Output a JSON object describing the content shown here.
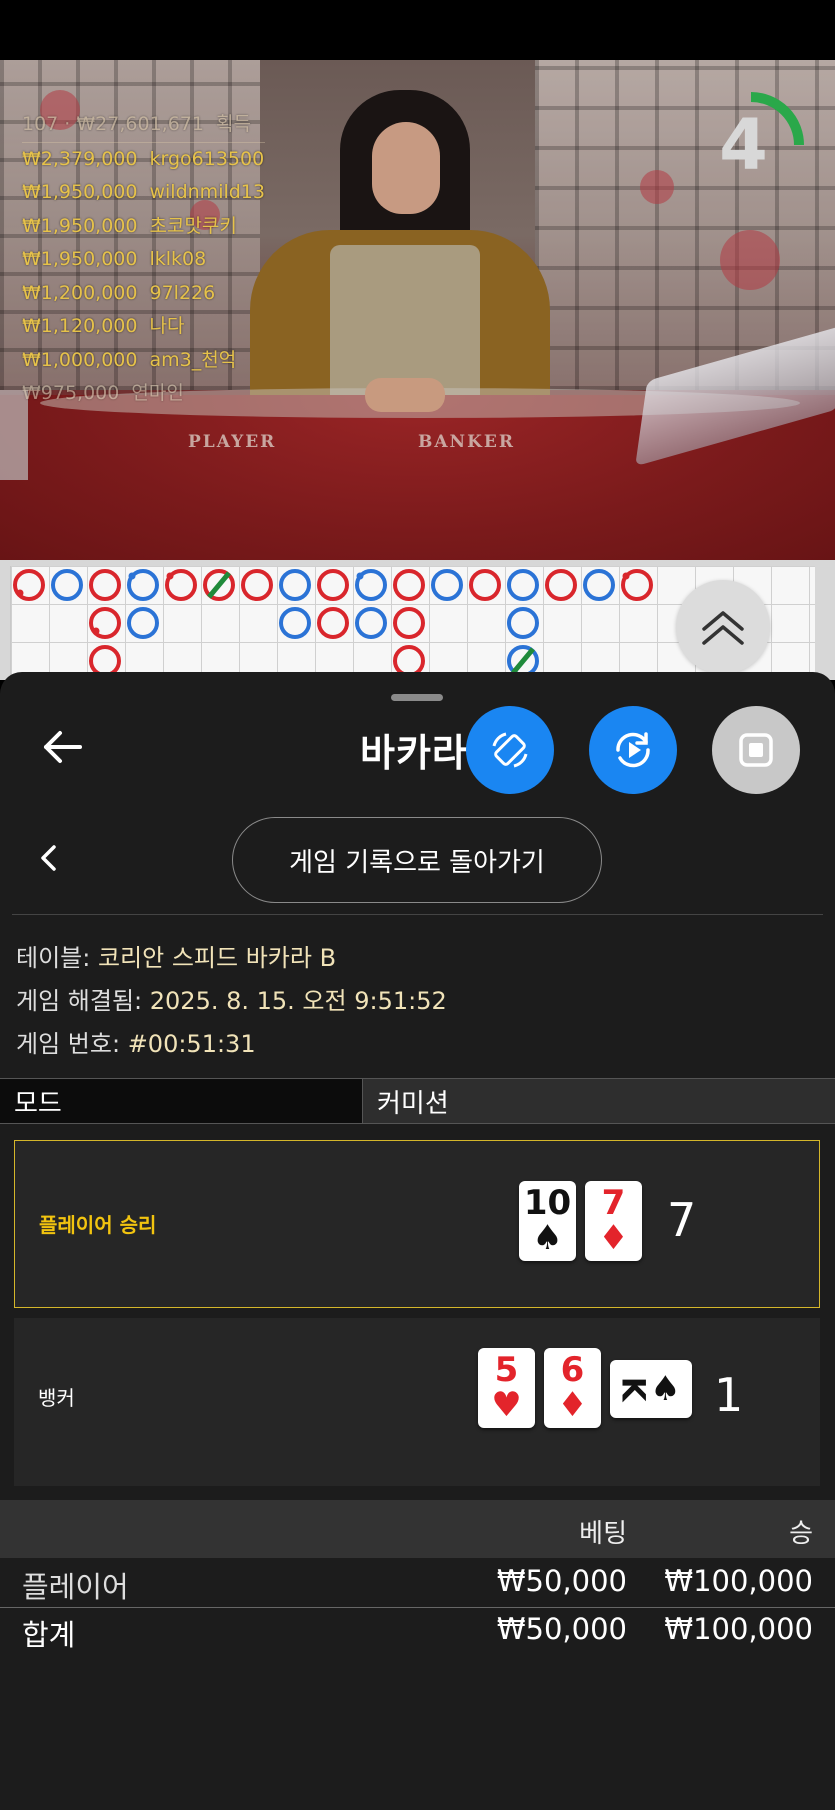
{
  "leaderboard": {
    "header": {
      "amount": "107 · ₩27,601,671",
      "label": "획득"
    },
    "rows": [
      {
        "amount": "₩2,379,000",
        "user": "krgo613500"
      },
      {
        "amount": "₩1,950,000",
        "user": "wildnmild13"
      },
      {
        "amount": "₩1,950,000",
        "user": "초코맛쿠키"
      },
      {
        "amount": "₩1,950,000",
        "user": "lklk08"
      },
      {
        "amount": "₩1,200,000",
        "user": "97l226"
      },
      {
        "amount": "₩1,120,000",
        "user": "나다"
      },
      {
        "amount": "₩1,000,000",
        "user": "am3_천억"
      },
      {
        "amount": "₩975,000",
        "user": "연마인"
      }
    ]
  },
  "table_felt": {
    "player": "PLAYER",
    "banker": "BANKER"
  },
  "timer": {
    "seconds": "4",
    "remaining_fraction": 0.25,
    "color": "#2aa84a"
  },
  "sheet": {
    "title": "바카라",
    "history_button": "게임 기록으로 돌아가기"
  },
  "info": {
    "table_label": "테이블:",
    "table_value": "코리안 스피드 바카라 B",
    "resolved_label": "게임 해결됨:",
    "resolved_value": "2025. 8. 15. 오전 9:51:52",
    "number_label": "게임 번호:",
    "number_value": "#00:51:31"
  },
  "mode": {
    "left": "모드",
    "right": "커미션"
  },
  "hands": {
    "player": {
      "label": "플레이어 승리",
      "cards": [
        {
          "rank": "10",
          "suit": "♠"
        },
        {
          "rank": "7",
          "suit": "♦"
        }
      ],
      "total": "7"
    },
    "banker": {
      "label": "뱅커",
      "cards": [
        {
          "rank": "5",
          "suit": "♥"
        },
        {
          "rank": "6",
          "suit": "♦"
        },
        {
          "rank": "K",
          "suit": "♠"
        }
      ],
      "total": "1"
    }
  },
  "bets": {
    "headers": {
      "bet": "베팅",
      "win": "승"
    },
    "rows": [
      {
        "name": "플레이어",
        "bet": "₩50,000",
        "win": "₩100,000"
      },
      {
        "name": "합계",
        "bet": "₩50,000",
        "win": "₩100,000"
      }
    ]
  },
  "colors": {
    "accent_blue": "#1a86f2",
    "win_gold": "#f2c40f",
    "player_circle": "#2b73d6",
    "banker_circle": "#d9262c",
    "tie_slash": "#1f8a3a"
  }
}
